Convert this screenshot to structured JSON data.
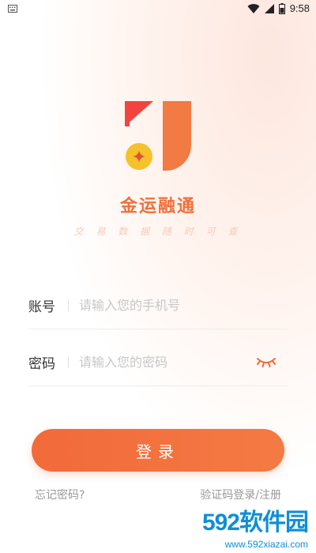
{
  "status_bar": {
    "time": "9:58",
    "icons": [
      "keyboard-icon",
      "wifi-icon",
      "signal-icon",
      "battery-icon"
    ]
  },
  "brand": {
    "name": "金运融通",
    "tagline": "交 易 数 据 随 时 可 查",
    "colors": {
      "primary": "#f26a3a",
      "red": "#f1443e",
      "gold": "#f5c22b",
      "orange": "#f27a43"
    }
  },
  "login": {
    "account_label": "账号",
    "account_placeholder": "请输入您的手机号",
    "account_value": "",
    "password_label": "密码",
    "password_placeholder": "请输入您的密码",
    "password_value": "",
    "submit_label": "登录",
    "forgot_label": "忘记密码?",
    "sms_login_label": "验证码登录/注册"
  },
  "watermark": {
    "logo": "592软件园",
    "url": "www.592xiazai.com"
  }
}
